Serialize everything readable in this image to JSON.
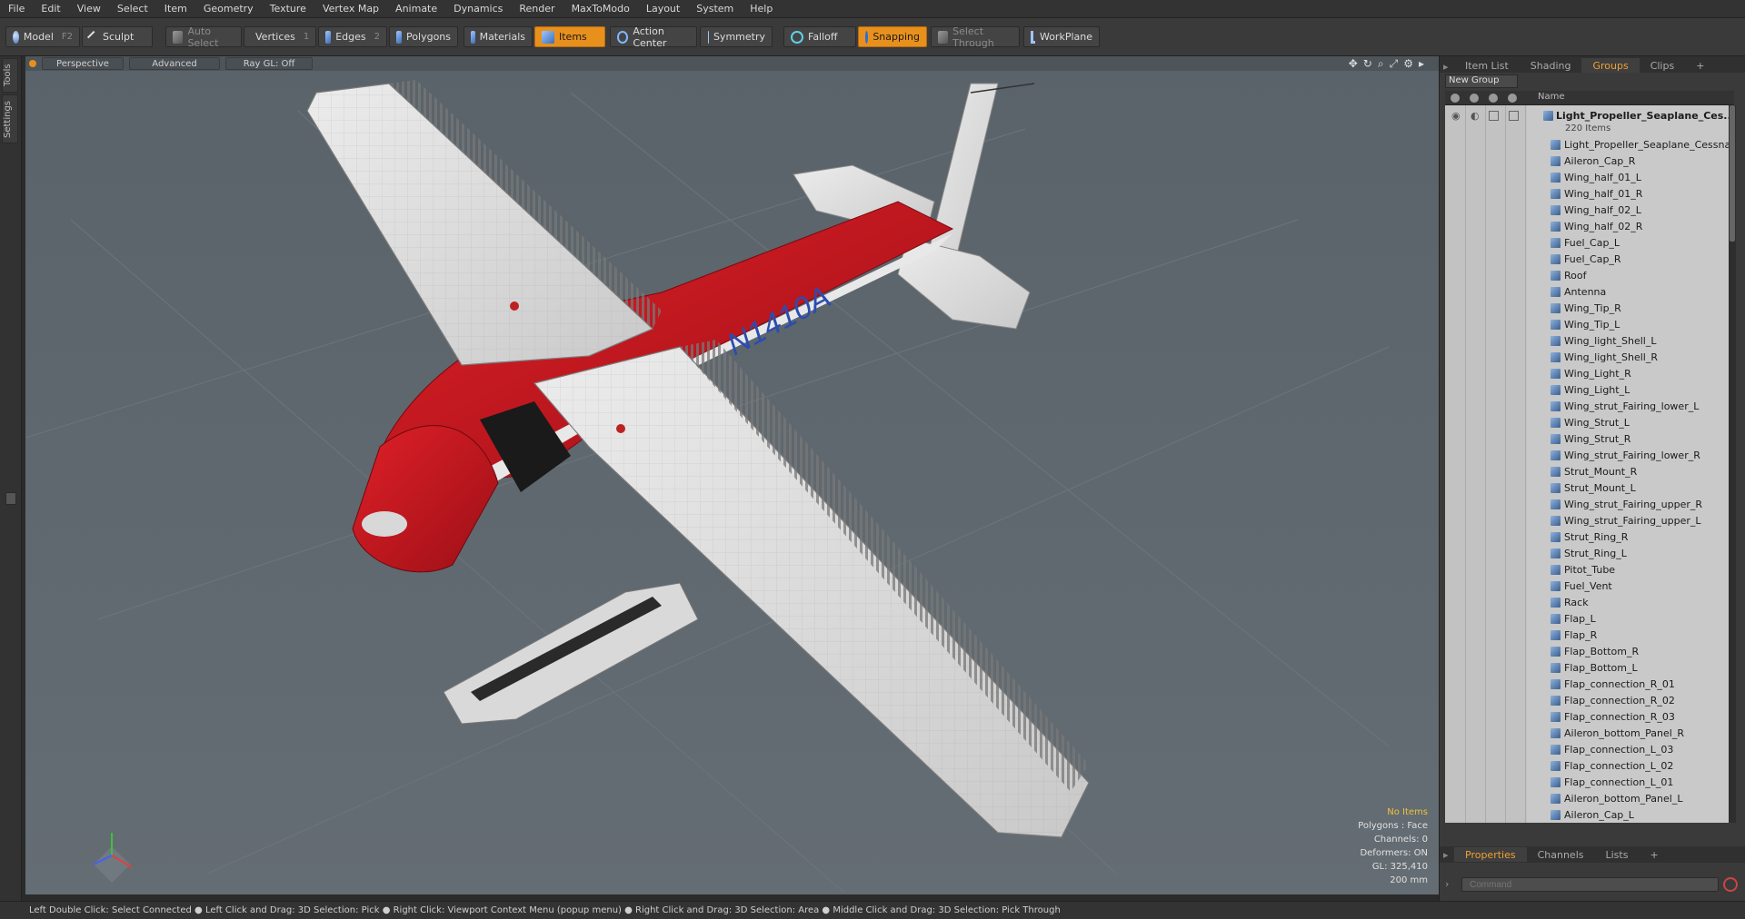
{
  "menu": [
    "File",
    "Edit",
    "View",
    "Select",
    "Item",
    "Geometry",
    "Texture",
    "Vertex Map",
    "Animate",
    "Dynamics",
    "Render",
    "MaxToModo",
    "Layout",
    "System",
    "Help"
  ],
  "toolbar": {
    "model": "Model",
    "model_key": "F2",
    "sculpt": "Sculpt",
    "auto_select": "Auto Select",
    "vertices": "Vertices",
    "vertices_num": "1",
    "edges": "Edges",
    "edges_num": "2",
    "polygons": "Polygons",
    "materials": "Materials",
    "items": "Items",
    "action_center": "Action Center",
    "symmetry": "Symmetry",
    "falloff": "Falloff",
    "snapping": "Snapping",
    "select_through": "Select Through",
    "workplane": "WorkPlane"
  },
  "left_tabs": [
    "Tools",
    "Settings"
  ],
  "viewport": {
    "perspective": "Perspective",
    "advanced": "Advanced",
    "raygl": "Ray GL: Off",
    "registration": "N1410A",
    "hud": {
      "no_items": "No Items",
      "polygons": "Polygons : Face",
      "channels": "Channels: 0",
      "deformers": "Deformers: ON",
      "gl": "GL: 325,410",
      "scale": "200 mm"
    }
  },
  "right_panel": {
    "tabs": [
      "Item List",
      "Shading",
      "Groups",
      "Clips"
    ],
    "active_tab": "Groups",
    "new_group": "New Group",
    "name_header": "Name",
    "root": "Light_Propeller_Seaplane_Ces...",
    "count": "220 Items",
    "items": [
      "Light_Propeller_Seaplane_Cessna...",
      "Aileron_Cap_R",
      "Wing_half_01_L",
      "Wing_half_01_R",
      "Wing_half_02_L",
      "Wing_half_02_R",
      "Fuel_Cap_L",
      "Fuel_Cap_R",
      "Roof",
      "Antenna",
      "Wing_Tip_R",
      "Wing_Tip_L",
      "Wing_light_Shell_L",
      "Wing_light_Shell_R",
      "Wing_Light_R",
      "Wing_Light_L",
      "Wing_strut_Fairing_lower_L",
      "Wing_Strut_L",
      "Wing_Strut_R",
      "Wing_strut_Fairing_lower_R",
      "Strut_Mount_R",
      "Strut_Mount_L",
      "Wing_strut_Fairing_upper_R",
      "Wing_strut_Fairing_upper_L",
      "Strut_Ring_R",
      "Strut_Ring_L",
      "Pitot_Tube",
      "Fuel_Vent",
      "Rack",
      "Flap_L",
      "Flap_R",
      "Flap_Bottom_R",
      "Flap_Bottom_L",
      "Flap_connection_R_01",
      "Flap_connection_R_02",
      "Flap_connection_R_03",
      "Aileron_bottom_Panel_R",
      "Flap_connection_L_03",
      "Flap_connection_L_02",
      "Flap_connection_L_01",
      "Aileron_bottom_Panel_L",
      "Aileron_Cap_L"
    ],
    "bottom_tabs": [
      "Properties",
      "Channels",
      "Lists"
    ],
    "command_placeholder": "Command"
  },
  "status": "Left Double Click: Select Connected ● Left Click and Drag: 3D Selection: Pick ● Right Click: Viewport Context Menu (popup menu) ● Right Click and Drag: 3D Selection: Area ● Middle Click and Drag: 3D Selection: Pick Through"
}
